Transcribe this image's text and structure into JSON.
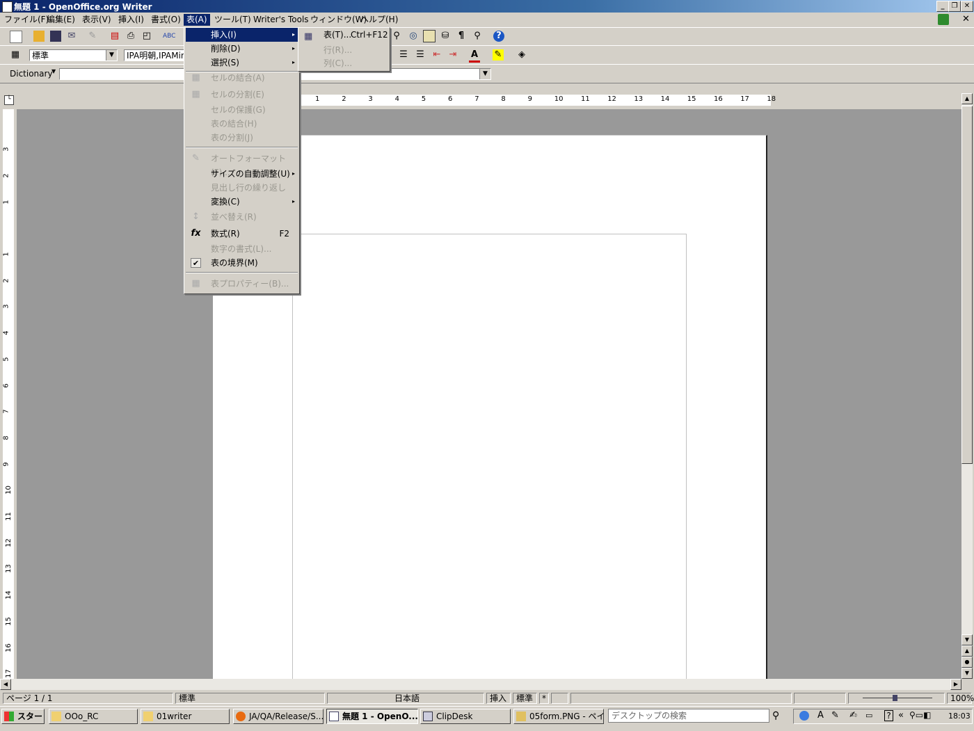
{
  "window": {
    "title": "無題 1 - OpenOffice.org Writer",
    "buttons": [
      "_",
      "❐",
      "✕"
    ]
  },
  "menubar": {
    "items": [
      "ファイル(F)",
      "編集(E)",
      "表示(V)",
      "挿入(I)",
      "書式(O)",
      "表(A)",
      "ツール(T)",
      "Writer's Tools",
      "ウィンドウ(W)",
      "ヘルプ(H)"
    ],
    "close": "✕"
  },
  "formatting": {
    "style": "標準",
    "font": "IPA明朝,IPAMinc"
  },
  "dictionary_bar": {
    "label": "Dictionary",
    "value": ""
  },
  "table_menu": {
    "items": [
      {
        "label": "挿入(I)",
        "submenu": "▸",
        "highlighted": true
      },
      {
        "label": "削除(D)",
        "submenu": "▸"
      },
      {
        "label": "選択(S)",
        "submenu": "▸"
      },
      {
        "label": "セルの結合(A)",
        "disabled": true
      },
      {
        "label": "セルの分割(E)",
        "disabled": true
      },
      {
        "label": "セルの保護(G)",
        "disabled": true
      },
      {
        "label": "表の結合(H)",
        "disabled": true
      },
      {
        "label": "表の分割(J)",
        "disabled": true
      },
      {
        "label": "オートフォーマット(F)...",
        "disabled": true
      },
      {
        "label": "サイズの自動調整(U)",
        "submenu": "▸"
      },
      {
        "label": "見出し行の繰り返し(K)",
        "disabled": true
      },
      {
        "label": "変換(C)",
        "submenu": "▸"
      },
      {
        "label": "並べ替え(R)",
        "disabled": true
      },
      {
        "label": "数式(R)",
        "accel": "F2"
      },
      {
        "label": "数字の書式(L)...",
        "disabled": true
      },
      {
        "label": "表の境界(M)",
        "checked": true
      },
      {
        "label": "表プロパティー(B)...",
        "disabled": true
      }
    ]
  },
  "insert_submenu": {
    "items": [
      {
        "label": "表(T)...",
        "accel": "Ctrl+F12"
      },
      {
        "label": "行(R)...",
        "disabled": true
      },
      {
        "label": "列(C)...",
        "disabled": true
      }
    ]
  },
  "ruler": {
    "h_numbers": [
      "1",
      "2",
      "3",
      "4",
      "5",
      "6",
      "7",
      "8",
      "9",
      "10",
      "11",
      "12",
      "13",
      "14",
      "15",
      "16",
      "17",
      "18"
    ],
    "v_top": [
      "3",
      "2",
      "1"
    ],
    "v_numbers": [
      "1",
      "2",
      "3",
      "4",
      "5",
      "6",
      "7",
      "8",
      "9",
      "10",
      "11",
      "12",
      "13",
      "14",
      "15",
      "16",
      "17"
    ]
  },
  "statusbar": {
    "page": "ページ 1 / 1",
    "style": "標準",
    "language": "日本語",
    "insert_mode": "挿入",
    "selection_mode": "標準",
    "modified": "*",
    "zoom": "100%"
  },
  "taskbar": {
    "start": "スタート",
    "buttons": [
      "OOo_RC",
      "01writer",
      "JA/QA/Release/S...",
      "無題 1 - OpenO...",
      "ClipDesk",
      "05form.PNG - ペイ..."
    ],
    "search_placeholder": "デスクトップの検索",
    "clock": "18:03"
  },
  "colors": {
    "title_bar": "#0a246a",
    "menu_highlight": "#0a246a",
    "workspace_bg": "#999999"
  }
}
